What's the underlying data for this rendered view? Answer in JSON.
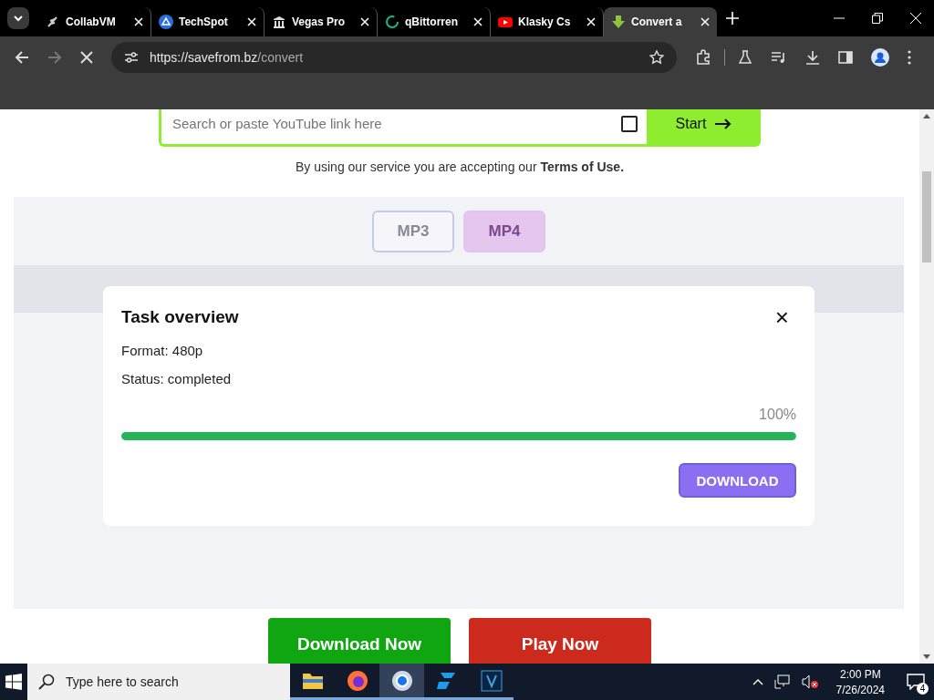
{
  "browser": {
    "tabs": [
      {
        "title": "CollabVM",
        "selected": false
      },
      {
        "title": "TechSpot",
        "selected": false
      },
      {
        "title": "Vegas Pro",
        "selected": false
      },
      {
        "title": "qBittorren",
        "selected": false
      },
      {
        "title": "Klasky Cs",
        "selected": false
      },
      {
        "title": "Convert a",
        "selected": true
      }
    ],
    "url_host": "https://savefrom.bz",
    "url_path": "/convert",
    "loading": true
  },
  "page": {
    "search": {
      "placeholder": "Search or paste YouTube link here"
    },
    "start_button": "Start",
    "terms": "By using our service you are accepting our **Terms of Use.**",
    "formats": [
      {
        "label": "MP3",
        "selected": false
      },
      {
        "label": "MP4",
        "selected": true
      }
    ],
    "bottom_buttons": [
      {
        "label": "Download Now",
        "kind": "download"
      },
      {
        "label": "Play Now",
        "kind": "play"
      }
    ]
  },
  "dialog": {
    "title": "Task overview",
    "close": "×",
    "lines": [
      "Format: 480p",
      "Status: completed"
    ],
    "percent": "100%",
    "level": 1,
    "button": "DOWNLOAD"
  },
  "taskbar": {
    "search_placeholder": "Type here to search",
    "apps": [
      {
        "kind": "files",
        "selected": false
      },
      {
        "kind": "firefox",
        "selected": false
      },
      {
        "kind": "chrome",
        "selected": true
      },
      {
        "kind": "blue",
        "selected": false
      },
      {
        "kind": "v",
        "selected": false
      }
    ],
    "time": "2:00 PM",
    "date": "7/26/2024",
    "notifications": "4"
  }
}
